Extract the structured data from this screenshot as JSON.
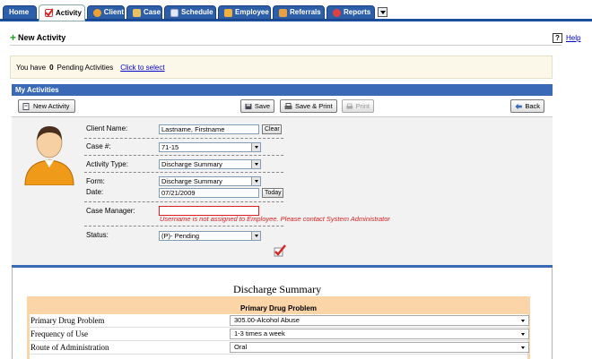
{
  "tabs": [
    {
      "label": "Home",
      "active": false,
      "icon": "none"
    },
    {
      "label": "Activity",
      "active": true,
      "icon": "checkbox-icon"
    },
    {
      "label": "Client",
      "active": false,
      "icon": "client-icon"
    },
    {
      "label": "Case",
      "active": false,
      "icon": "case-icon"
    },
    {
      "label": "Schedule",
      "active": false,
      "icon": "schedule-icon"
    },
    {
      "label": "Employee",
      "active": false,
      "icon": "employee-icon"
    },
    {
      "label": "Referrals",
      "active": false,
      "icon": "referrals-icon"
    },
    {
      "label": "Reports",
      "active": false,
      "icon": "reports-icon"
    }
  ],
  "page": {
    "title": "New Activity",
    "help_label": "Help",
    "help_glyph": "?"
  },
  "pending": {
    "prefix": "You have",
    "count": "0",
    "suffix": "Pending Activities",
    "link": "Click to select"
  },
  "panel": {
    "title": "My Activities"
  },
  "toolbar": {
    "new_activity": "New Activity",
    "save": "Save",
    "save_print": "Save & Print",
    "print": "Print",
    "back": "Back"
  },
  "form": {
    "client_name_label": "Client Name:",
    "client_name_value": "Lastname, Firstname",
    "clear_label": "Clear",
    "case_label": "Case #:",
    "case_value": "71-15",
    "activity_type_label": "Activity Type:",
    "activity_type_value": "Discharge Summary",
    "form_label": "Form:",
    "form_value": "Discharge Summary",
    "date_label": "Date:",
    "date_value": "07/21/2009",
    "today_label": "Today",
    "case_manager_label": "Case Manager:",
    "case_manager_value": "",
    "error_message": "Username is not assigned to Employee. Please contact System Administrator",
    "status_label": "Status:",
    "status_value": "(P)- Pending"
  },
  "discharge": {
    "title": "Discharge Summary",
    "section": "Primary Drug Problem",
    "rows": [
      {
        "label": "Primary Drug Problem",
        "value": "305.00-Alcohol Abuse"
      },
      {
        "label": "Frequency of Use",
        "value": "1-3 times a week"
      },
      {
        "label": "Route of Administration",
        "value": "Oral"
      }
    ]
  },
  "colors": {
    "tab_blue": "#2d5ea8",
    "panel_blue": "#3a69b8",
    "error_red": "#e02020",
    "section_orange": "#fbd4a8"
  }
}
